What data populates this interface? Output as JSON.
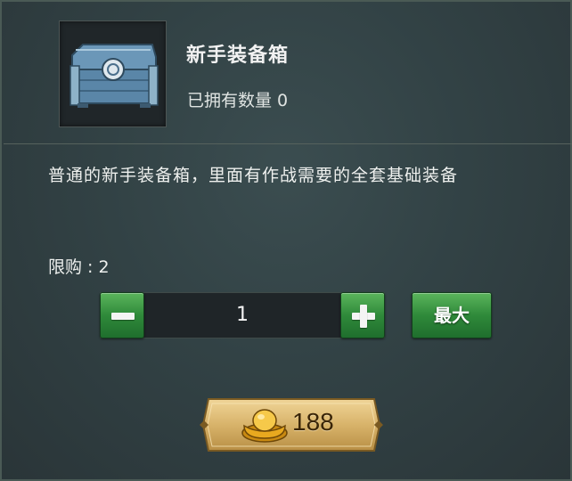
{
  "item": {
    "name": "新手装备箱",
    "owned": "已拥有数量 0",
    "icon": "treasure-chest-icon",
    "description": "普通的新手装备箱，里面有作战需要的全套基础装备"
  },
  "purchase": {
    "limit": "限购 : 2",
    "quantity": "1",
    "max_label": "最大",
    "price": "188",
    "currency_icon": "gold-ingot-icon"
  },
  "colors": {
    "button_green": "#2f8a3a",
    "buy_gold": "#d8b36a",
    "panel_bg": "#324245"
  }
}
